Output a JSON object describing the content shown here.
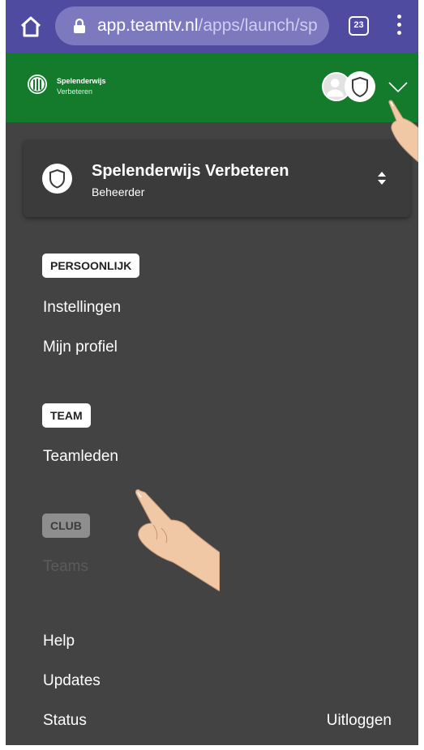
{
  "browser": {
    "url_host": "app.teamtv.nl",
    "url_rest": "/apps/launch/sp",
    "tab_count": "23",
    "icons": [
      "home-icon",
      "lock-icon",
      "tabs-icon",
      "menu-icon"
    ]
  },
  "header": {
    "team_name": "Spelenderwijs",
    "team_subtitle": "Verbeteren",
    "brand_color": "#157b2c"
  },
  "switcher": {
    "title": "Spelenderwijs Verbeteren",
    "role": "Beheerder"
  },
  "sections": {
    "personal": {
      "label": "PERSOONLIJK",
      "items": [
        "Instellingen",
        "Mijn profiel"
      ]
    },
    "team": {
      "label": "TEAM",
      "items": [
        "Teamleden"
      ]
    },
    "club": {
      "label": "CLUB",
      "items": [
        "Teams"
      ]
    }
  },
  "footer": {
    "help": "Help",
    "updates": "Updates",
    "status": "Status",
    "logout": "Uitloggen"
  }
}
